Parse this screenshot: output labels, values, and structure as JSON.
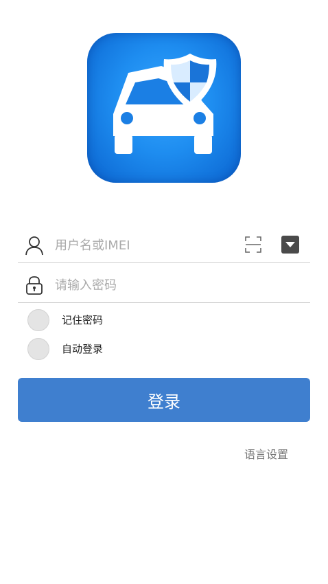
{
  "app": {
    "icon_name": "car-shield-icon",
    "accent_color": "#3f7fcf"
  },
  "form": {
    "username": {
      "placeholder": "用户名或IMEI",
      "value": ""
    },
    "password": {
      "placeholder": "请输入密码",
      "value": ""
    },
    "remember_label": "记住密码",
    "auto_login_label": "自动登录",
    "remember_checked": false,
    "auto_login_checked": false
  },
  "actions": {
    "login_label": "登录",
    "language_label": "语言设置"
  }
}
